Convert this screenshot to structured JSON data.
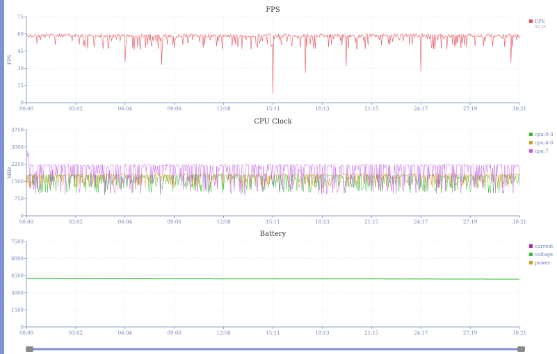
{
  "charts": [
    {
      "title": "FPS",
      "type": "line",
      "ylabel": "FPS",
      "ylim": [
        0,
        75
      ],
      "yticks": [
        "0",
        "15",
        "30",
        "45",
        "60",
        "75"
      ],
      "legend": [
        {
          "name": "FPS",
          "color": "#e8505b",
          "value": "56.39"
        }
      ],
      "series_summary": [
        {
          "name": "FPS",
          "baseline": 60,
          "min": 8,
          "dips": [
            {
              "t": "06:04",
              "v": 35
            },
            {
              "t": "08:20",
              "v": 33
            },
            {
              "t": "15:11",
              "v": 8
            },
            {
              "t": "17:10",
              "v": 26
            },
            {
              "t": "19:40",
              "v": 32
            },
            {
              "t": "24:17",
              "v": 27
            },
            {
              "t": "29:50",
              "v": 35
            }
          ]
        }
      ]
    },
    {
      "title": "CPU Clock",
      "type": "line",
      "ylabel": "MHz",
      "ylim": [
        0,
        3750
      ],
      "yticks": [
        "0",
        "750",
        "1500",
        "2250",
        "3000",
        "3750"
      ],
      "legend": [
        {
          "name": "cpu:0-3",
          "color": "#2ec02e"
        },
        {
          "name": "cpu:4-6",
          "color": "#d89a1a"
        },
        {
          "name": "cpu:7",
          "color": "#c25be8"
        }
      ],
      "series_summary": [
        {
          "name": "cpu:0-3",
          "high": 1800,
          "low": 1000
        },
        {
          "name": "cpu:4-6",
          "high": 1850,
          "low": 1200
        },
        {
          "name": "cpu:7",
          "high": 2250,
          "low": 900,
          "peak": 3000
        }
      ]
    },
    {
      "title": "Battery",
      "type": "line",
      "ylabel": "",
      "ylim": [
        0,
        7500
      ],
      "yticks": [
        "0",
        "1500",
        "3000",
        "4500",
        "6000",
        "7500"
      ],
      "legend": [
        {
          "name": "current",
          "color": "#b020a8"
        },
        {
          "name": "voltage",
          "color": "#2ec02e"
        },
        {
          "name": "power",
          "color": "#d89a1a"
        }
      ],
      "series_summary": [
        {
          "name": "voltage",
          "values_by_time": [
            4250,
            4230,
            4220,
            4200
          ]
        }
      ]
    }
  ],
  "x_ticks": [
    "00:00",
    "03:02",
    "06:04",
    "09:06",
    "12:08",
    "15:11",
    "18:13",
    "21:15",
    "24:17",
    "27:19",
    "30:21"
  ],
  "colors": {
    "axis": "#6f7fb0",
    "grid": "#e2e6f0",
    "slider": "#7f92d6",
    "handle": "#8a8a8a"
  }
}
